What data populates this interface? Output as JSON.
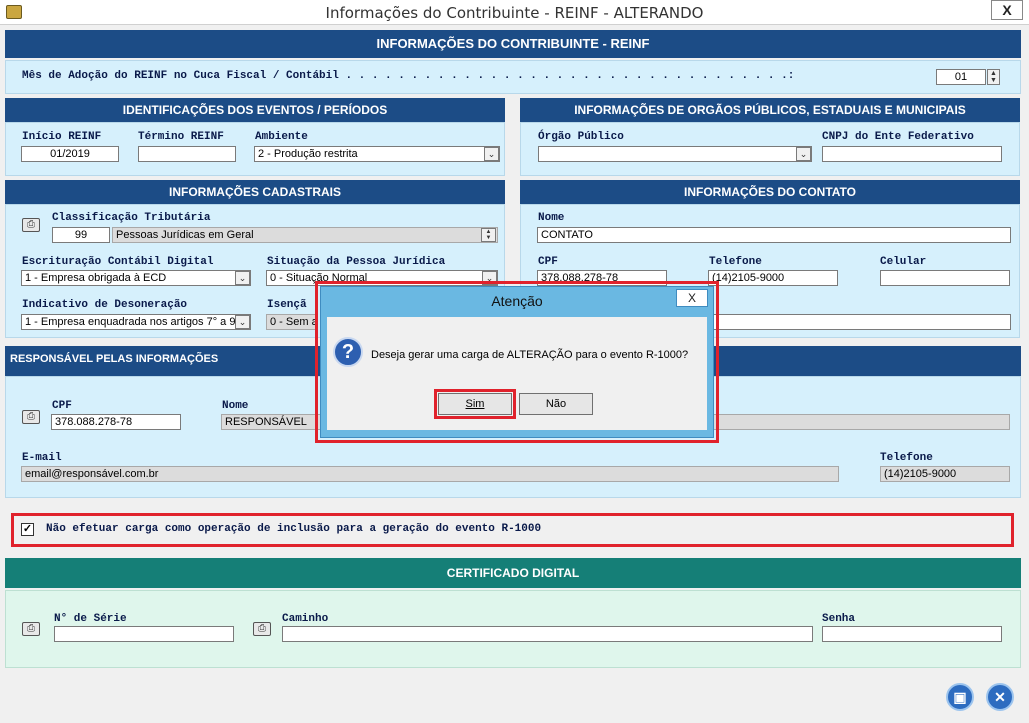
{
  "window": {
    "title": "Informações do Contribuinte   -   REINF   -   ALTERANDO",
    "close": "X"
  },
  "header": {
    "banner": "INFORMAÇÕES DO CONTRIBUINTE   -   REINF",
    "adoption_label": "Mês de Adoção do REINF no Cuca Fiscal / Contábil . . . . . . . . . . . . . . . . . . . . . . . . . . . . . . . . . .:",
    "adoption_value": "01"
  },
  "identificacoes": {
    "title": "IDENTIFICAÇÕES DOS EVENTOS / PERÍODOS",
    "inicio_label": "Início REINF",
    "inicio_value": "01/2019",
    "termino_label": "Término REINF",
    "termino_value": "",
    "ambiente_label": "Ambiente",
    "ambiente_value": "2 - Produção restrita"
  },
  "orgaos": {
    "title": "INFORMAÇÕES DE ORGÃOS PÚBLICOS, ESTADUAIS E MUNICIPAIS",
    "orgao_label": "Órgão Público",
    "orgao_value": "",
    "cnpj_label": "CNPJ do Ente Federativo",
    "cnpj_value": ""
  },
  "cadastrais": {
    "title": "INFORMAÇÕES CADASTRAIS",
    "classificacao_label": "Classificação Tributária",
    "classificacao_code": "99",
    "classificacao_desc": "Pessoas Jurídicas em Geral",
    "escrituracao_label": "Escrituração Contábil Digital",
    "escrituracao_value": "1 - Empresa obrigada à ECD",
    "situacao_label": "Situação da Pessoa Jurídica",
    "situacao_value": "0 - Situação Normal",
    "desoneracao_label": "Indicativo de Desoneração",
    "desoneracao_value": "1 - Empresa enquadrada nos artigos 7° a 9°",
    "isencao_label": "Isençã",
    "isencao_value": "0 - Sem a"
  },
  "contato": {
    "title": "INFORMAÇÕES DO CONTATO",
    "nome_label": "Nome",
    "nome_value": "CONTATO",
    "cpf_label": "CPF",
    "cpf_value": "378.088.278-78",
    "telefone_label": "Telefone",
    "telefone_value": "(14)2105-9000",
    "celular_label": "Celular",
    "celular_value": ""
  },
  "responsavel": {
    "title": "RESPONSÁVEL PELAS INFORMAÇÕES",
    "cpf_label": "CPF",
    "cpf_value": "378.088.278-78",
    "nome_label": "Nome",
    "nome_value": "RESPONSÁVEL",
    "email_label": "E-mail",
    "email_value": "email@responsável.com.br",
    "telefone_label": "Telefone",
    "telefone_value": "(14)2105-9000"
  },
  "checkbox": {
    "label": "Não efetuar carga como operação de inclusão para a geração do evento R-1000",
    "checked": true
  },
  "certificado": {
    "title": "CERTIFICADO DIGITAL",
    "serie_label": "N° de Série",
    "serie_value": "",
    "caminho_label": "Caminho",
    "caminho_value": "",
    "senha_label": "Senha",
    "senha_value": ""
  },
  "dialog": {
    "title": "Atenção",
    "close": "X",
    "message": "Deseja gerar uma carga de ALTERAÇÃO para o evento R-1000?",
    "yes": "Sim",
    "no": "Não"
  },
  "colors": {
    "banner": "#1c4c86",
    "panel": "#d6f0fc",
    "cert_banner": "#157f77",
    "highlight": "#e0222c"
  },
  "icons": [
    "app-icon",
    "printer-icon",
    "question-icon",
    "save-icon",
    "exit-icon"
  ]
}
